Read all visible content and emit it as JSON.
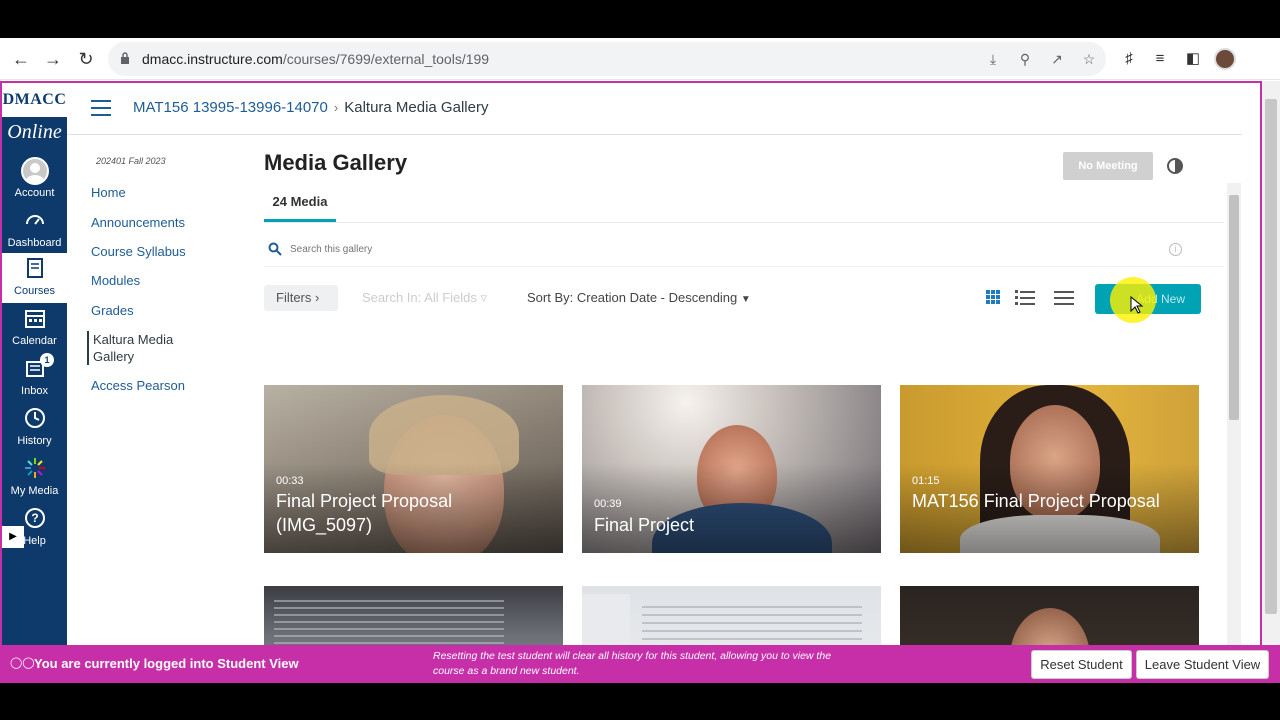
{
  "browser": {
    "url_host": "dmacc.instructure.com",
    "url_path": "/courses/7699/external_tools/199"
  },
  "globalnav": {
    "logo_top": "DMACC",
    "logo_bottom": "Online",
    "items": [
      {
        "label": "Account",
        "icon": "avatar-icon"
      },
      {
        "label": "Dashboard",
        "icon": "dashboard-icon"
      },
      {
        "label": "Courses",
        "icon": "courses-icon"
      },
      {
        "label": "Calendar",
        "icon": "calendar-icon"
      },
      {
        "label": "Inbox",
        "icon": "inbox-icon",
        "badge": "1"
      },
      {
        "label": "History",
        "icon": "history-icon"
      },
      {
        "label": "My Media",
        "icon": "my-media-icon"
      },
      {
        "label": "Help",
        "icon": "help-icon"
      }
    ]
  },
  "breadcrumb": {
    "course": "MAT156 13995-13996-14070",
    "current": "Kaltura Media Gallery"
  },
  "coursenav": {
    "term": "202401 Fall 2023",
    "items": [
      "Home",
      "Announcements",
      "Course Syllabus",
      "Modules",
      "Grades",
      "Kaltura Media Gallery",
      "Access Pearson"
    ]
  },
  "gallery": {
    "title": "Media Gallery",
    "tab": "24 Media",
    "no_meeting": "No Meeting",
    "search_placeholder": "Search this gallery",
    "filters": "Filters",
    "search_in": "Search In: All Fields",
    "sort_by": "Sort By: Creation Date - Descending",
    "add_new": "Add New",
    "accent": "#00a3b4"
  },
  "media": [
    {
      "duration": "00:33",
      "title": "Final Project Proposal (IMG_5097)"
    },
    {
      "duration": "00:39",
      "title": "Final Project"
    },
    {
      "duration": "01:15",
      "title": "MAT156 Final Project Proposal"
    },
    {
      "duration": "",
      "title": ""
    },
    {
      "duration": "",
      "title": ""
    },
    {
      "duration": "",
      "title": ""
    }
  ],
  "student_view": {
    "message": "You are currently logged into Student View",
    "note": "Resetting the test student will clear all history for this student, allowing you to view the course as a brand new student.",
    "reset": "Reset Student",
    "leave": "Leave Student View",
    "color": "#c62fa8"
  }
}
